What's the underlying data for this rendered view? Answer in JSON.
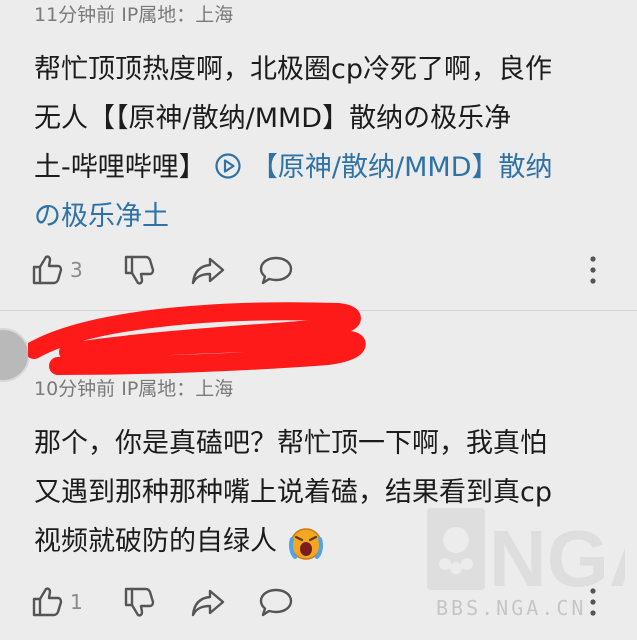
{
  "comment1": {
    "meta": "11分钟前  IP属地：上海",
    "text_lines": [
      "帮忙顶顶热度啊，北极圈cp冷死了啊，良作",
      "无人【【原神/散纳/MMD】散纳の极乐净"
    ],
    "line3_prefix": "土-哔哩哔哩】 ",
    "link_part1": "【原神/散纳/MMD】散纳",
    "link_part2": "の极乐净土",
    "like_count": "3"
  },
  "comment2": {
    "meta": "10分钟前  IP属地：上海",
    "text_lines": [
      "那个，你是真磕吧？帮忙顶一下啊，我真怕",
      "又遇到那种那种嘴上说着磕，结果看到真cp"
    ],
    "line3": "视频就破防的自绿人",
    "like_count": "1"
  },
  "watermark": {
    "text": "BBS.NGA.CN",
    "logo": "NGA"
  },
  "colors": {
    "background": "#ececec",
    "link": "#2f72a6",
    "meta": "#7a7a7a",
    "redaction": "#ff1a1a"
  },
  "icons": [
    "thumb-up-icon",
    "thumb-down-icon",
    "share-icon",
    "comment-icon",
    "more-vertical-icon",
    "play-circle-icon",
    "crying-emoji-icon"
  ]
}
